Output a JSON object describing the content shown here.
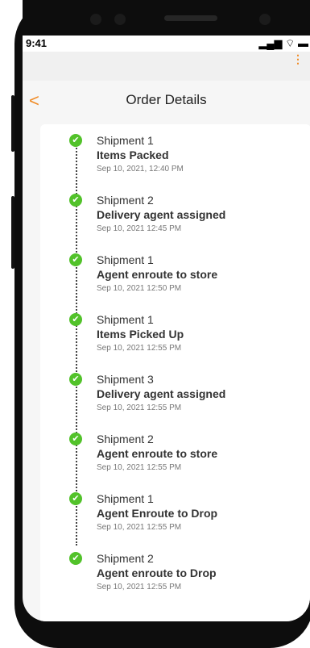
{
  "statusbar": {
    "time": "9:41"
  },
  "header": {
    "title": "Order Details",
    "back_label": "<",
    "menu_label": "⋮"
  },
  "events": [
    {
      "shipment": "Shipment 1",
      "status": "Items Packed",
      "timestamp": "Sep 10, 2021, 12:40 PM"
    },
    {
      "shipment": "Shipment 2",
      "status": "Delivery agent assigned",
      "timestamp": "Sep 10, 2021 12:45 PM"
    },
    {
      "shipment": "Shipment 1",
      "status": "Agent enroute to store",
      "timestamp": "Sep 10, 2021 12:50 PM"
    },
    {
      "shipment": "Shipment 1",
      "status": "Items Picked Up",
      "timestamp": "Sep 10, 2021 12:55 PM"
    },
    {
      "shipment": "Shipment 3",
      "status": "Delivery agent assigned",
      "timestamp": "Sep 10, 2021 12:55 PM"
    },
    {
      "shipment": "Shipment 2",
      "status": "Agent enroute to store",
      "timestamp": "Sep 10, 2021 12:55 PM"
    },
    {
      "shipment": "Shipment 1",
      "status": "Agent Enroute to Drop",
      "timestamp": "Sep 10, 2021 12:55 PM"
    },
    {
      "shipment": "Shipment 2",
      "status": "Agent enroute to Drop",
      "timestamp": "Sep 10, 2021 12:55 PM"
    }
  ],
  "colors": {
    "accent": "#f08a24",
    "success": "#52c22a",
    "text": "#333333",
    "muted": "#777777"
  }
}
